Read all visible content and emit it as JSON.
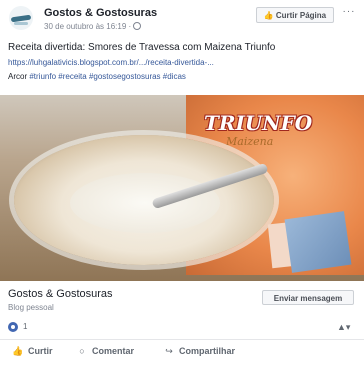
{
  "header": {
    "page_name": "Gostos & Gostosuras",
    "timestamp": "30 de outubro às 16:19 ·",
    "like_page_label": "Curtir Página",
    "more_label": "···"
  },
  "post": {
    "title": "Receita divertida: Smores de Travessa com Maizena Triunfo",
    "link": "https://luhgalativicis.blogspot.com.br/.../receita-divertida-...",
    "tags_prefix": "Arcor",
    "tags": "#triunfo #receita #gostosegostosuras #dicas"
  },
  "photo": {
    "brand": "TRIUNFO",
    "brand_sub": "Maizena"
  },
  "card": {
    "name": "Gostos & Gostosuras",
    "category": "Blog pessoal",
    "message_label": "Enviar mensagem"
  },
  "reactions": {
    "count": "1",
    "menu_icon": "▲▾"
  },
  "actions": {
    "like_label": "Curtir",
    "comment_label": "Comentar",
    "share_label": "Compartilhar"
  },
  "icons": {
    "like": "thumbs-up-icon",
    "comment": "speech-bubble-icon",
    "share": "share-arrow-icon",
    "globe": "globe-icon"
  },
  "colors": {
    "link": "#365899",
    "text": "#1d2129",
    "muted": "#7f8591",
    "fb_blue": "#4267b2"
  }
}
